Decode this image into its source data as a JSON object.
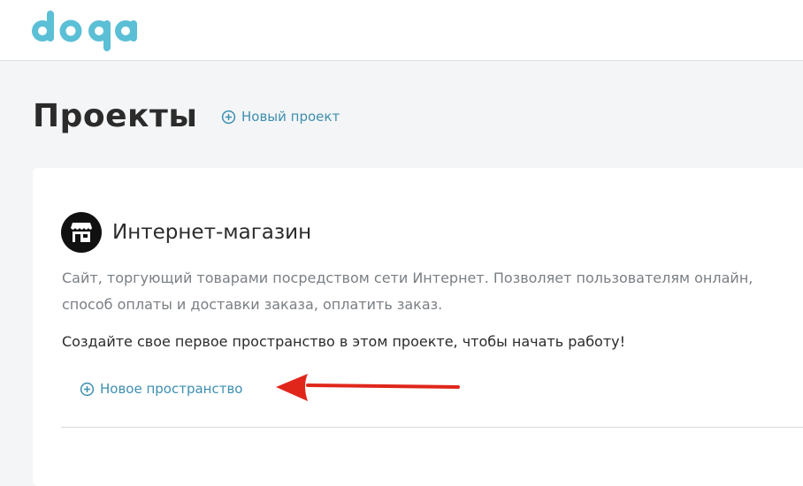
{
  "header": {
    "logo_text": "doqa"
  },
  "main": {
    "title": "Проекты",
    "new_project_label": "Новый проект"
  },
  "project": {
    "name": "Интернет-магазин",
    "avatar_icon": "storefront-icon",
    "description_lines": [
      "Сайт, торгующий товарами посредством сети Интернет. Позволяет пользователям онлайн,",
      "способ оплаты и доставки заказа, оплатить заказ."
    ],
    "cta_text": "Создайте свое первое пространство в этом проекте, чтобы начать работу!",
    "new_space_label": "Новое пространство"
  },
  "annotation": {
    "arrow_color": "#e0261b"
  },
  "colors": {
    "brand": "#5bbfd6",
    "link": "#3d8fb0"
  }
}
